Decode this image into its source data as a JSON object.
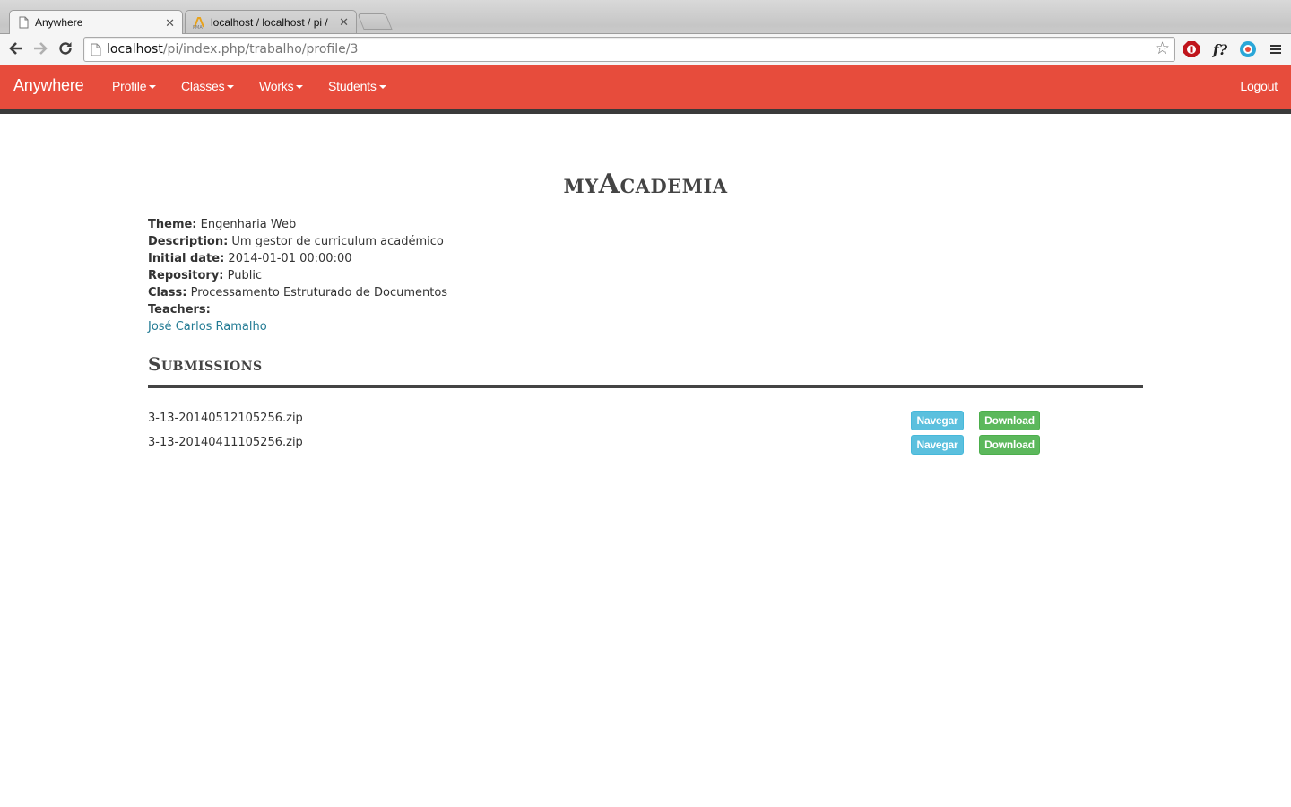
{
  "browser": {
    "tabs": [
      {
        "title": "Anywhere",
        "icon": "page-icon",
        "active": true
      },
      {
        "title": "localhost / localhost / pi /",
        "icon": "phpmyadmin-icon",
        "active": false
      }
    ],
    "url_host": "localhost",
    "url_path": "/pi/index.php/trabalho/profile/3",
    "ext_f_label": "f?"
  },
  "navbar": {
    "brand": "Anywhere",
    "items": [
      {
        "label": "Profile"
      },
      {
        "label": "Classes"
      },
      {
        "label": "Works"
      },
      {
        "label": "Students"
      }
    ],
    "logout": "Logout",
    "color": "#e74c3c"
  },
  "work": {
    "title": "myAcademia",
    "fields": [
      {
        "label": "Theme:",
        "value": "Engenharia Web"
      },
      {
        "label": "Description:",
        "value": "Um gestor de curriculum académico"
      },
      {
        "label": "Initial date:",
        "value": "2014-01-01 00:00:00"
      },
      {
        "label": "Repository:",
        "value": "Public"
      },
      {
        "label": "Class:",
        "value": "Processamento Estruturado de Documentos"
      },
      {
        "label": "Teachers:",
        "value": ""
      }
    ],
    "teacher": "José Carlos Ramalho"
  },
  "submissions": {
    "title": "Submissions",
    "files": [
      {
        "name": "3-13-20140512105256.zip",
        "browse": "Navegar",
        "download": "Download"
      },
      {
        "name": "3-13-20140411105256.zip",
        "browse": "Navegar",
        "download": "Download"
      }
    ]
  }
}
